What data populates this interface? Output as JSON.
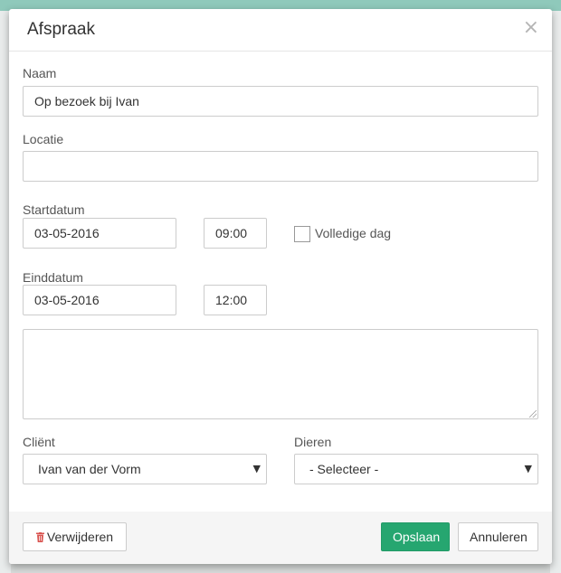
{
  "modal": {
    "title": "Afspraak",
    "close_symbol": "×"
  },
  "form": {
    "name_label": "Naam",
    "name_value": "Op bezoek bij Ivan",
    "location_label": "Locatie",
    "location_value": "",
    "start_label": "Startdatum",
    "start_date": "03-05-2016",
    "start_time": "09:00",
    "allday_label": "Volledige dag",
    "allday_checked": false,
    "end_label": "Einddatum",
    "end_date": "03-05-2016",
    "end_time": "12:00",
    "notes_value": "",
    "client_label": "Cliënt",
    "client_value": "Ivan van der Vorm",
    "animals_label": "Dieren",
    "animals_value": "- Selecteer -"
  },
  "footer": {
    "delete_label": "Verwijderen",
    "save_label": "Opslaan",
    "cancel_label": "Annuleren"
  },
  "colors": {
    "primary": "#26a670",
    "danger_icon": "#d9534f",
    "backdrop_top": "#8fc9bb"
  },
  "icons": {
    "close": "close-icon",
    "delete": "trash-icon",
    "select_caret": "caret-down-icon"
  }
}
